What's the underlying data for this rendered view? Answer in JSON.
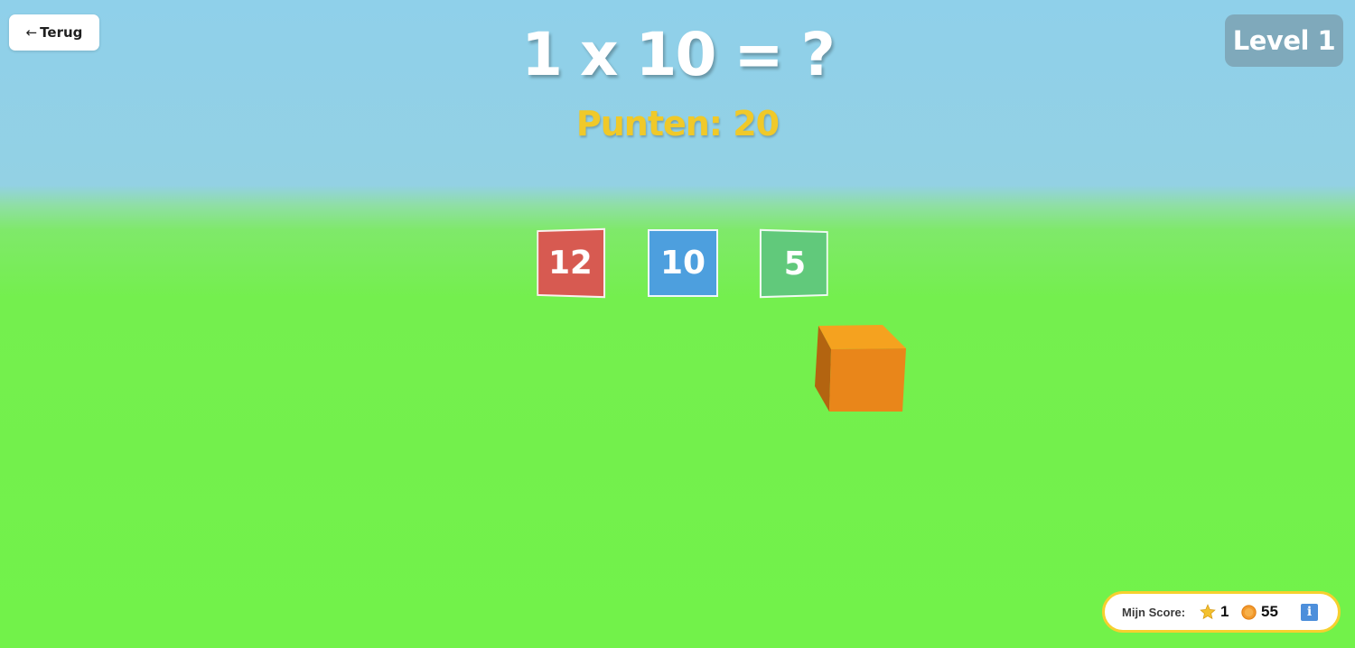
{
  "header": {
    "back_arrow": "←",
    "back_label": "Terug",
    "level_label": "Level 1"
  },
  "question": {
    "text": "1 x 10 = ?"
  },
  "points": {
    "text": "Punten: 20"
  },
  "answers": [
    {
      "value": "12",
      "color": "#d75a51"
    },
    {
      "value": "10",
      "color": "#4d9fde"
    },
    {
      "value": "5",
      "color": "#61c97b"
    }
  ],
  "player": {
    "color": "#f0901c"
  },
  "score_panel": {
    "label": "Mijn Score:",
    "stars": "1",
    "coins": "55",
    "star_icon": "star-icon",
    "coin_icon": "coin-icon",
    "info_icon": "info-icon",
    "info_glyph": "i",
    "border_color": "#f6d02e"
  },
  "colors": {
    "sky": "#8fd0ea",
    "grass": "#72f24a",
    "points_text": "#f0c929",
    "level_badge": "#7fa9bb"
  }
}
